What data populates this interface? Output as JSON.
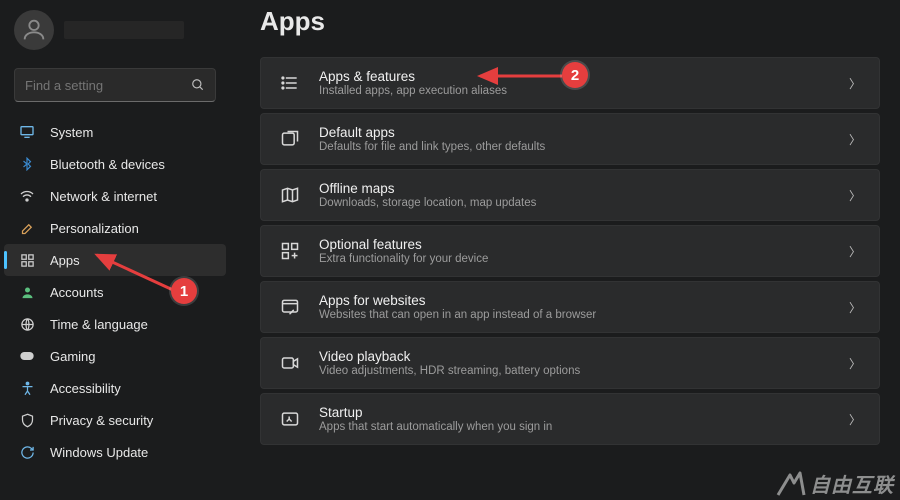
{
  "search": {
    "placeholder": "Find a setting"
  },
  "page": {
    "title": "Apps"
  },
  "sidebar": {
    "items": [
      {
        "label": "System"
      },
      {
        "label": "Bluetooth & devices"
      },
      {
        "label": "Network & internet"
      },
      {
        "label": "Personalization"
      },
      {
        "label": "Apps"
      },
      {
        "label": "Accounts"
      },
      {
        "label": "Time & language"
      },
      {
        "label": "Gaming"
      },
      {
        "label": "Accessibility"
      },
      {
        "label": "Privacy & security"
      },
      {
        "label": "Windows Update"
      }
    ]
  },
  "cards": [
    {
      "title": "Apps & features",
      "sub": "Installed apps, app execution aliases"
    },
    {
      "title": "Default apps",
      "sub": "Defaults for file and link types, other defaults"
    },
    {
      "title": "Offline maps",
      "sub": "Downloads, storage location, map updates"
    },
    {
      "title": "Optional features",
      "sub": "Extra functionality for your device"
    },
    {
      "title": "Apps for websites",
      "sub": "Websites that can open in an app instead of a browser"
    },
    {
      "title": "Video playback",
      "sub": "Video adjustments, HDR streaming, battery options"
    },
    {
      "title": "Startup",
      "sub": "Apps that start automatically when you sign in"
    }
  ],
  "annotations": {
    "badge1": "1",
    "badge2": "2"
  },
  "watermark": {
    "text": "自由互联"
  }
}
